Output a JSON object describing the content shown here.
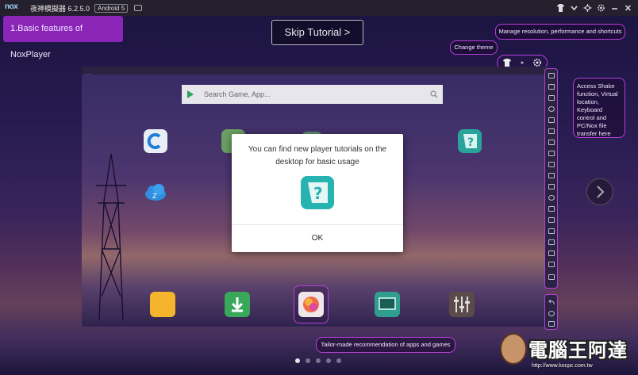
{
  "titlebar": {
    "logo_text": "nox",
    "app_title": "夜神模擬器 6.2.5.0",
    "android_badge": "Android 5",
    "icons": [
      "shirt-icon",
      "chevron-down-icon",
      "pin-icon",
      "gear-icon",
      "minimize-icon",
      "close-icon"
    ]
  },
  "tutorial": {
    "step_label": "1.Basic features of NoxPlayer",
    "skip_label": "Skip Tutorial >"
  },
  "callouts": {
    "resolution": "Manage resolution, performance and shortcuts",
    "theme": "Change theme",
    "shake": "Access Shake function, Virtual location, Keyboard control and PC/Nox file transfer here",
    "tailor": "Tailor-made recommendation of apps and games"
  },
  "emulator": {
    "window_label": "nox",
    "search_placeholder": "Search Game, App...",
    "desktop_icons": [
      "c-browser-icon",
      "green-app-icon",
      "folder-app-icon",
      "tutorial-question-icon",
      "cloud-app-icon"
    ],
    "dock_icons": [
      "file-manager-icon",
      "download-icon",
      "tailor-gallery-icon",
      "screen-app-icon",
      "settings-equalizer-icon"
    ]
  },
  "dialog": {
    "message": "You can find new player tutorials on the desktop for basic usage",
    "ok_label": "OK"
  },
  "pagination": {
    "total": 5,
    "active": 0
  },
  "watermark": {
    "brand": "電腦王阿達",
    "url": "http://www.kocpc.com.tw"
  },
  "colors": {
    "accent_purple": "#8a25b8",
    "callout_border": "#b43fd9",
    "dialog_bg": "#ffffff",
    "teal_icon": "#27b3b0"
  }
}
